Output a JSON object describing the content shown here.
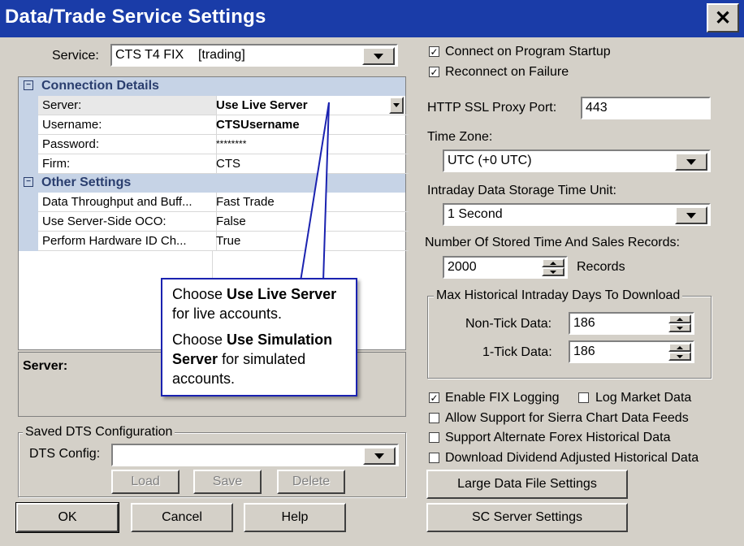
{
  "window": {
    "title": "Data/Trade Service Settings",
    "close_glyph": "✕"
  },
  "service": {
    "label": "Service:",
    "value": "CTS T4 FIX    [trading]"
  },
  "grid": {
    "sections": [
      {
        "title": "Connection Details",
        "rows": [
          {
            "name": "Server:",
            "value": "Use Live Server"
          },
          {
            "name": "Username:",
            "value": "CTSUsername"
          },
          {
            "name": "Password:",
            "value": "********"
          },
          {
            "name": "Firm:",
            "value": "CTS"
          }
        ]
      },
      {
        "title": "Other Settings",
        "rows": [
          {
            "name": "Data Throughput and Buff...",
            "value": "Fast Trade"
          },
          {
            "name": "Use Server-Side OCO:",
            "value": "False"
          },
          {
            "name": "Perform Hardware ID Ch...",
            "value": "True"
          }
        ]
      }
    ],
    "description_title": "Server:"
  },
  "callout": {
    "p1_a": "Choose ",
    "p1_b": "Use Live Server",
    "p1_c": " for live accounts.",
    "p2_a": "Choose ",
    "p2_b": "Use Simulation Server",
    "p2_c": " for simulated accounts."
  },
  "dts": {
    "group_title": "Saved DTS Configuration",
    "label": "DTS Config:",
    "value": "",
    "load": "Load",
    "save": "Save",
    "delete": "Delete"
  },
  "buttons": {
    "ok": "OK",
    "cancel": "Cancel",
    "help": "Help",
    "large_data": "Large Data File Settings",
    "sc_server": "SC Server Settings"
  },
  "right": {
    "connect_startup": {
      "label": "Connect on Program Startup",
      "checked": true
    },
    "reconnect": {
      "label": "Reconnect on Failure",
      "checked": true
    },
    "proxy_label": "HTTP SSL Proxy Port:",
    "proxy_value": "443",
    "tz_label": "Time Zone:",
    "tz_value": "UTC (+0 UTC)",
    "intraday_label": "Intraday Data Storage Time Unit:",
    "intraday_value": "1 Second",
    "records_label": "Number Of Stored Time And Sales Records:",
    "records_value": "2000",
    "records_unit": "Records",
    "hist_group": "Max Historical Intraday Days To Download",
    "nontick_label": "Non-Tick Data:",
    "nontick_value": "186",
    "onetick_label": "1-Tick Data:",
    "onetick_value": "186",
    "fix_logging": {
      "label": "Enable FIX Logging",
      "checked": true
    },
    "log_market": {
      "label": "Log Market Data",
      "checked": false
    },
    "allow_sierra": {
      "label": "Allow Support for Sierra Chart Data Feeds",
      "checked": false
    },
    "alt_forex": {
      "label": "Support Alternate Forex Historical Data",
      "checked": false
    },
    "dividend": {
      "label": "Download Dividend Adjusted Historical Data",
      "checked": false
    }
  }
}
